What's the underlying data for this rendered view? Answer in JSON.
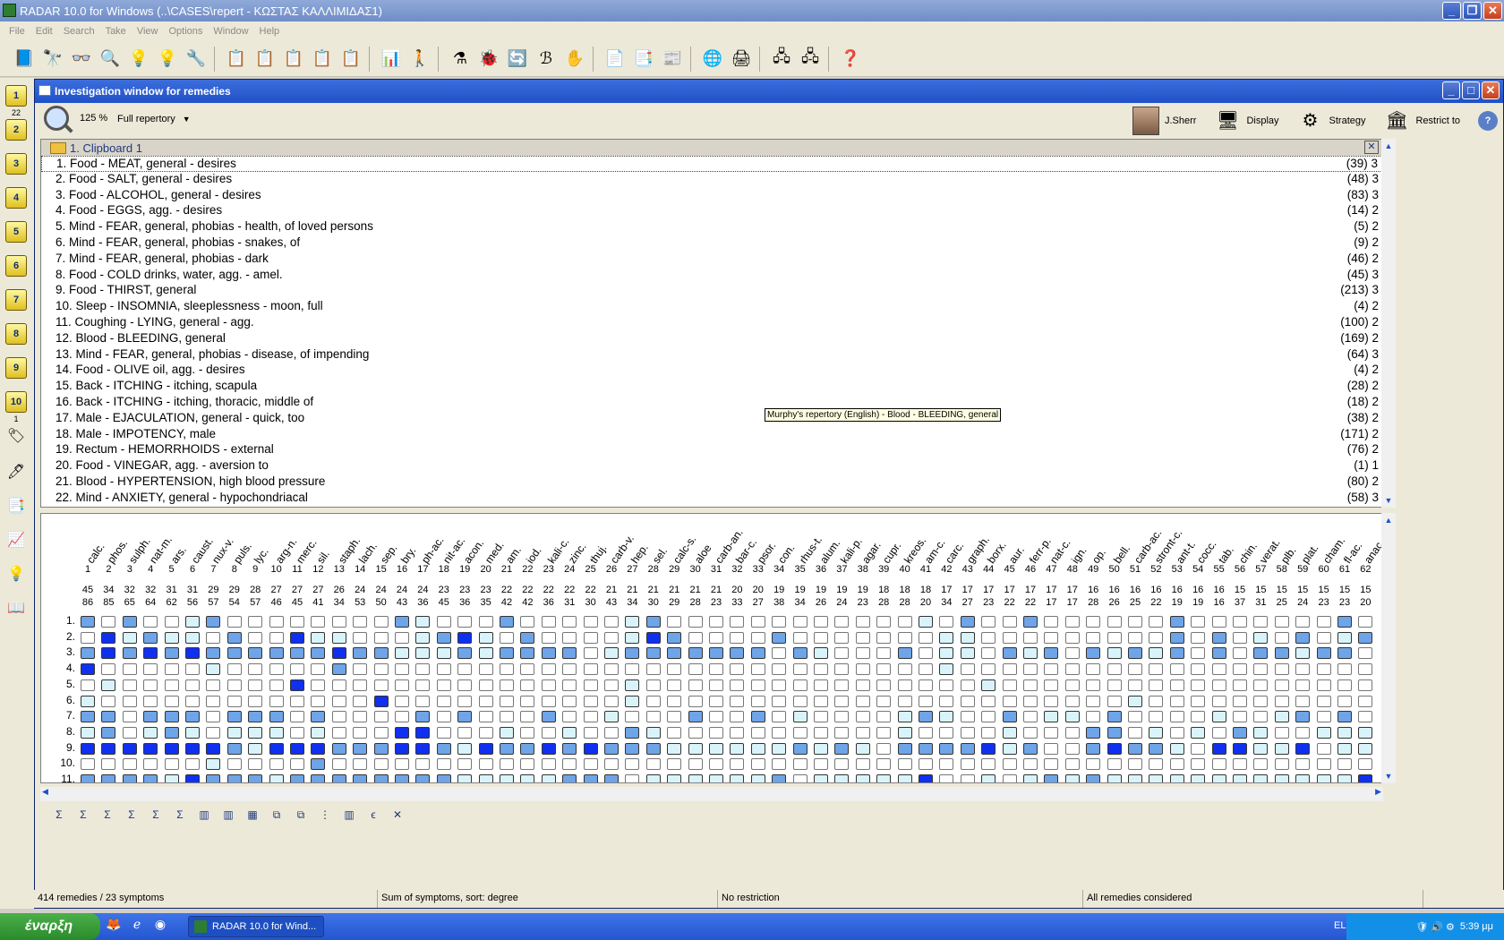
{
  "app": {
    "title": "RADAR 10.0 for Windows  (..\\CASES\\repert - ΚΩΣΤΑΣ ΚΑΛΛΙΜΙΔΑΣ1)",
    "menu": [
      "File",
      "Edit",
      "Search",
      "Take",
      "View",
      "Options",
      "Window",
      "Help"
    ]
  },
  "child": {
    "title": "Investigation window for remedies",
    "zoom": "125 %",
    "repertory": "Full repertory",
    "user": "J.Sherr",
    "display": "Display",
    "strategy": "Strategy",
    "restrict": "Restrict to"
  },
  "clipboard": {
    "name": "1.  Clipboard 1",
    "rubrics": [
      {
        "text": "1. Food - MEAT, general - desires",
        "count": "(39) 3"
      },
      {
        "text": "2. Food - SALT, general - desires",
        "count": "(48) 3"
      },
      {
        "text": "3. Food - ALCOHOL, general - desires",
        "count": "(83) 3"
      },
      {
        "text": "4. Food - EGGS, agg. - desires",
        "count": "(14) 2"
      },
      {
        "text": "5. Mind - FEAR, general, phobias - health, of loved persons",
        "count": "(5) 2"
      },
      {
        "text": "6. Mind - FEAR, general, phobias - snakes, of",
        "count": "(9) 2"
      },
      {
        "text": "7. Mind - FEAR, general, phobias - dark",
        "count": "(46) 2"
      },
      {
        "text": "8. Food - COLD drinks, water, agg. - amel.",
        "count": "(45) 3"
      },
      {
        "text": "9. Food - THIRST, general",
        "count": "(213) 3"
      },
      {
        "text": "10. Sleep - INSOMNIA, sleeplessness - moon, full",
        "count": "(4) 2"
      },
      {
        "text": "11. Coughing - LYING, general - agg.",
        "count": "(100) 2"
      },
      {
        "text": "12. Blood - BLEEDING, general",
        "count": "(169) 2"
      },
      {
        "text": "13. Mind - FEAR, general, phobias - disease, of impending",
        "count": "(64) 3"
      },
      {
        "text": "14. Food - OLIVE oil, agg. - desires",
        "count": "(4) 2"
      },
      {
        "text": "15. Back - ITCHING - itching, scapula",
        "count": "(28) 2"
      },
      {
        "text": "16. Back - ITCHING - itching, thoracic, middle of",
        "count": "(18) 2"
      },
      {
        "text": "17. Male - EJACULATION, general - quick, too",
        "count": "(38) 2"
      },
      {
        "text": "18. Male - IMPOTENCY, male",
        "count": "(171) 2"
      },
      {
        "text": "19. Rectum - HEMORRHOIDS - external",
        "count": "(76) 2"
      },
      {
        "text": "20. Food - VINEGAR, agg. - aversion to",
        "count": "(1) 1"
      },
      {
        "text": "21. Blood - HYPERTENSION, high blood pressure",
        "count": "(80) 2"
      },
      {
        "text": "22. Mind - ANXIETY, general - hypochondriacal",
        "count": "(58) 3"
      }
    ],
    "tooltip": "Murphy's repertory (English) - Blood - BLEEDING, general"
  },
  "grid": {
    "remedies": [
      {
        "n": "calc.",
        "a": "45",
        "b": "86"
      },
      {
        "n": "phos.",
        "a": "34",
        "b": "85"
      },
      {
        "n": "sulph.",
        "a": "32",
        "b": "65"
      },
      {
        "n": "nat-m.",
        "a": "32",
        "b": "64"
      },
      {
        "n": "ars.",
        "a": "31",
        "b": "62"
      },
      {
        "n": "caust.",
        "a": "31",
        "b": "56"
      },
      {
        "n": "nux-v.",
        "a": "29",
        "b": "57"
      },
      {
        "n": "puls.",
        "a": "29",
        "b": "54"
      },
      {
        "n": "lyc.",
        "a": "28",
        "b": "57"
      },
      {
        "n": "arg-n.",
        "a": "27",
        "b": "46"
      },
      {
        "n": "merc.",
        "a": "27",
        "b": "45"
      },
      {
        "n": "sil.",
        "a": "27",
        "b": "41"
      },
      {
        "n": "staph.",
        "a": "26",
        "b": "34"
      },
      {
        "n": "lach.",
        "a": "24",
        "b": "53"
      },
      {
        "n": "sep.",
        "a": "24",
        "b": "50"
      },
      {
        "n": "bry.",
        "a": "24",
        "b": "43"
      },
      {
        "n": "ph-ac.",
        "a": "24",
        "b": "36"
      },
      {
        "n": "nit-ac.",
        "a": "23",
        "b": "45"
      },
      {
        "n": "acon.",
        "a": "23",
        "b": "36"
      },
      {
        "n": "med.",
        "a": "23",
        "b": "35"
      },
      {
        "n": "am.",
        "a": "22",
        "b": "42"
      },
      {
        "n": "iod.",
        "a": "22",
        "b": "42"
      },
      {
        "n": "kali-c.",
        "a": "22",
        "b": "36"
      },
      {
        "n": "zinc.",
        "a": "22",
        "b": "31"
      },
      {
        "n": "thuj.",
        "a": "22",
        "b": "30"
      },
      {
        "n": "carb-v.",
        "a": "21",
        "b": "43"
      },
      {
        "n": "hep.",
        "a": "21",
        "b": "34"
      },
      {
        "n": "sel.",
        "a": "21",
        "b": "30"
      },
      {
        "n": "calc-s.",
        "a": "21",
        "b": "29"
      },
      {
        "n": "aloe",
        "a": "21",
        "b": "28"
      },
      {
        "n": "carb-an.",
        "a": "21",
        "b": "23"
      },
      {
        "n": "bar-c.",
        "a": "20",
        "b": "33"
      },
      {
        "n": "psor.",
        "a": "20",
        "b": "27"
      },
      {
        "n": "con.",
        "a": "19",
        "b": "38"
      },
      {
        "n": "rhus-t.",
        "a": "19",
        "b": "34"
      },
      {
        "n": "alum.",
        "a": "19",
        "b": "26"
      },
      {
        "n": "kali-p.",
        "a": "19",
        "b": "24"
      },
      {
        "n": "agar.",
        "a": "19",
        "b": "23"
      },
      {
        "n": "cupr.",
        "a": "18",
        "b": "28"
      },
      {
        "n": "kreos.",
        "a": "18",
        "b": "28"
      },
      {
        "n": "am-c.",
        "a": "18",
        "b": "20"
      },
      {
        "n": "carc.",
        "a": "17",
        "b": "34"
      },
      {
        "n": "graph.",
        "a": "17",
        "b": "27"
      },
      {
        "n": "borx.",
        "a": "17",
        "b": "23"
      },
      {
        "n": "aur.",
        "a": "17",
        "b": "22"
      },
      {
        "n": "ferr-p.",
        "a": "17",
        "b": "22"
      },
      {
        "n": "nat-c.",
        "a": "17",
        "b": "17"
      },
      {
        "n": "ign.",
        "a": "17",
        "b": "17"
      },
      {
        "n": "op.",
        "a": "16",
        "b": "28"
      },
      {
        "n": "bell.",
        "a": "16",
        "b": "26"
      },
      {
        "n": "carb-ac.",
        "a": "16",
        "b": "25"
      },
      {
        "n": "stront-c.",
        "a": "16",
        "b": "22"
      },
      {
        "n": "ant-t.",
        "a": "16",
        "b": "19"
      },
      {
        "n": "cocc.",
        "a": "16",
        "b": "19"
      },
      {
        "n": "tab.",
        "a": "16",
        "b": "16"
      },
      {
        "n": "chin.",
        "a": "15",
        "b": "37"
      },
      {
        "n": "verat.",
        "a": "15",
        "b": "31"
      },
      {
        "n": "plb.",
        "a": "15",
        "b": "25"
      },
      {
        "n": "plat.",
        "a": "15",
        "b": "24"
      },
      {
        "n": "cham.",
        "a": "15",
        "b": "23"
      },
      {
        "n": "fl-ac.",
        "a": "15",
        "b": "23"
      },
      {
        "n": "anac.",
        "a": "15",
        "b": "20"
      }
    ],
    "rows": [
      "31311231000011132000300000231000000000002031030000003000000031",
      "14232213114221102342031000243000030010000220000000003031203023",
      "34343433333343322232333302333333313201030221323032323030332330",
      "40000020000030000000000000000000000000010200000000000000000000",
      "02001000004000000000000000200000000000000002000000000000000000",
      "20000000000000400000000000200000000000000000000000200000000000",
      "33033303330300003030003002000300302000023200302203000020023030",
      "23023202220200044000211200320000000000020000200033020203200222",
      "44444443244433344324334343332222223232033334230034332044224022",
      "00000020000300000000000000000000000000000000000000000000000000",
      "33332433323333333322222333022222230222224002023232222222222224"
    ],
    "row_labels": [
      "1.",
      "2.",
      "3.",
      "4.",
      "5.",
      "6.",
      "7.",
      "8.",
      "9.",
      "10.",
      "11."
    ]
  },
  "status": {
    "left": "414 remedies / 23 symptoms",
    "sort": "Sum of symptoms, sort: degree",
    "restriction": "No restriction",
    "considered": "All remedies considered"
  },
  "taskbar": {
    "start": "έναρξη",
    "task": "RADAR 10.0 for Wind...",
    "lang": "EL",
    "time": "5:39 μμ"
  },
  "sidebar": {
    "counts": [
      "22",
      "1"
    ]
  }
}
